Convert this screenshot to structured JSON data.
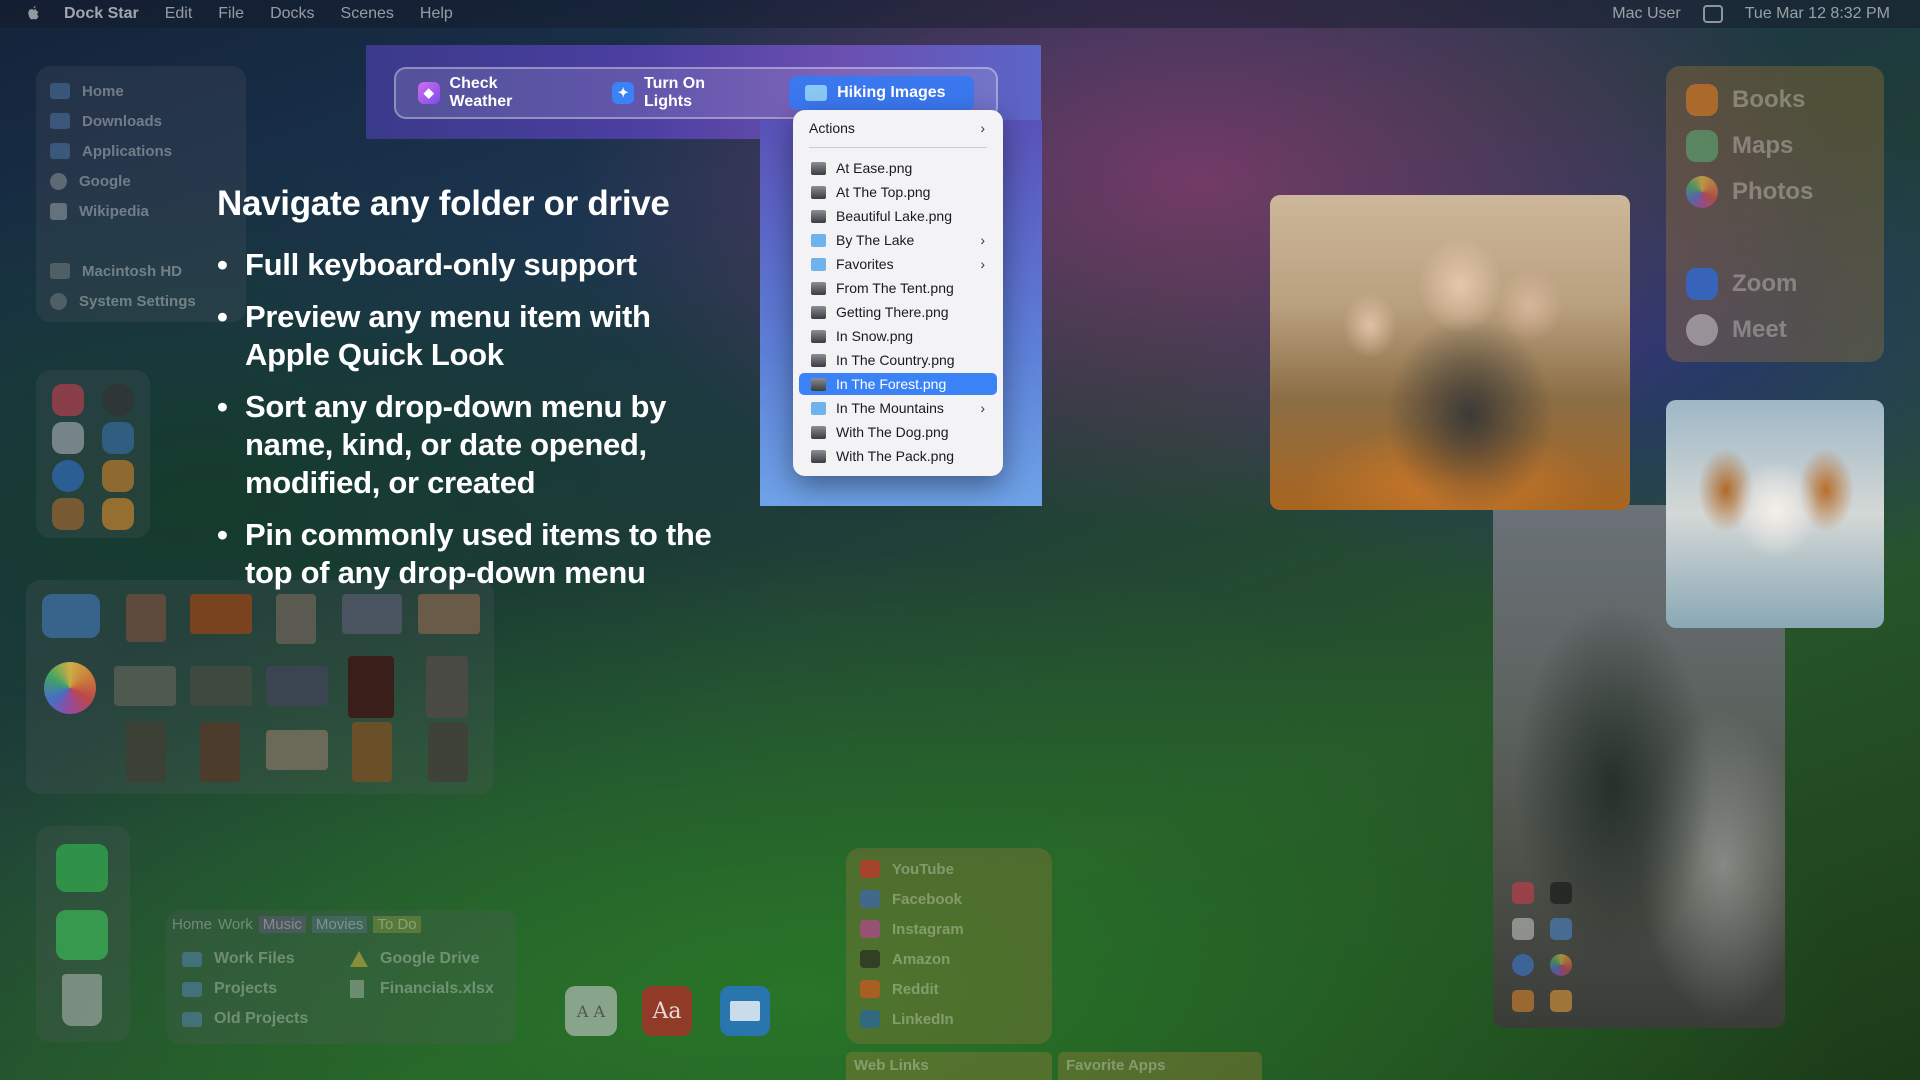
{
  "menubar": {
    "app_name": "Dock Star",
    "items": [
      "Edit",
      "File",
      "Docks",
      "Scenes",
      "Help"
    ],
    "user": "Mac User",
    "datetime": "Tue Mar 12  8:32 PM"
  },
  "favorites": {
    "items": [
      "Home",
      "Downloads",
      "Applications",
      "Google",
      "Wikipedia",
      "Macintosh HD",
      "System Settings"
    ]
  },
  "hero": {
    "title": "Navigate any folder or drive",
    "bullets": [
      "Full keyboard-only support",
      "Preview any menu item with Apple Quick Look",
      "Sort any drop-down menu by name, kind, or date opened, modified, or created",
      "Pin commonly used items to the top of any drop-down menu"
    ]
  },
  "shortcuts": {
    "buttons": [
      "Check Weather",
      "Turn On Lights",
      "Hiking Images"
    ]
  },
  "dropdown": {
    "header": "Actions",
    "items": [
      {
        "label": "At Ease.png",
        "kind": "image",
        "submenu": false
      },
      {
        "label": "At The Top.png",
        "kind": "image",
        "submenu": false
      },
      {
        "label": "Beautiful Lake.png",
        "kind": "image",
        "submenu": false
      },
      {
        "label": "By The Lake",
        "kind": "folder",
        "submenu": true
      },
      {
        "label": "Favorites",
        "kind": "folder",
        "submenu": true
      },
      {
        "label": "From The Tent.png",
        "kind": "image",
        "submenu": false
      },
      {
        "label": "Getting There.png",
        "kind": "image",
        "submenu": false
      },
      {
        "label": "In Snow.png",
        "kind": "image",
        "submenu": false
      },
      {
        "label": "In The Country.png",
        "kind": "image",
        "submenu": false
      },
      {
        "label": "In The Forest.png",
        "kind": "image",
        "submenu": false,
        "selected": true
      },
      {
        "label": "In The Mountains",
        "kind": "folder",
        "submenu": true
      },
      {
        "label": "With The Dog.png",
        "kind": "image",
        "submenu": false
      },
      {
        "label": "With The Pack.png",
        "kind": "image",
        "submenu": false
      }
    ]
  },
  "apps_panel": {
    "items": [
      "Books",
      "Maps",
      "Photos",
      "Zoom",
      "Meet"
    ]
  },
  "tabs_panel": {
    "tabs": [
      "Home",
      "Work",
      "Music",
      "Movies",
      "To Do"
    ],
    "items_left": [
      "Work Files",
      "Projects",
      "Old Projects"
    ],
    "items_right": [
      "Google Drive",
      "Financials.xlsx"
    ]
  },
  "web_links": {
    "items": [
      "YouTube",
      "Facebook",
      "Instagram",
      "Amazon",
      "Reddit",
      "LinkedIn"
    ],
    "tab_labels": [
      "Web Links",
      "Favorite Apps"
    ]
  },
  "dictionary_icon_text": "Aa",
  "colors": {
    "accent": "#3b82f6",
    "menu_bg": "#f3f3f6"
  }
}
